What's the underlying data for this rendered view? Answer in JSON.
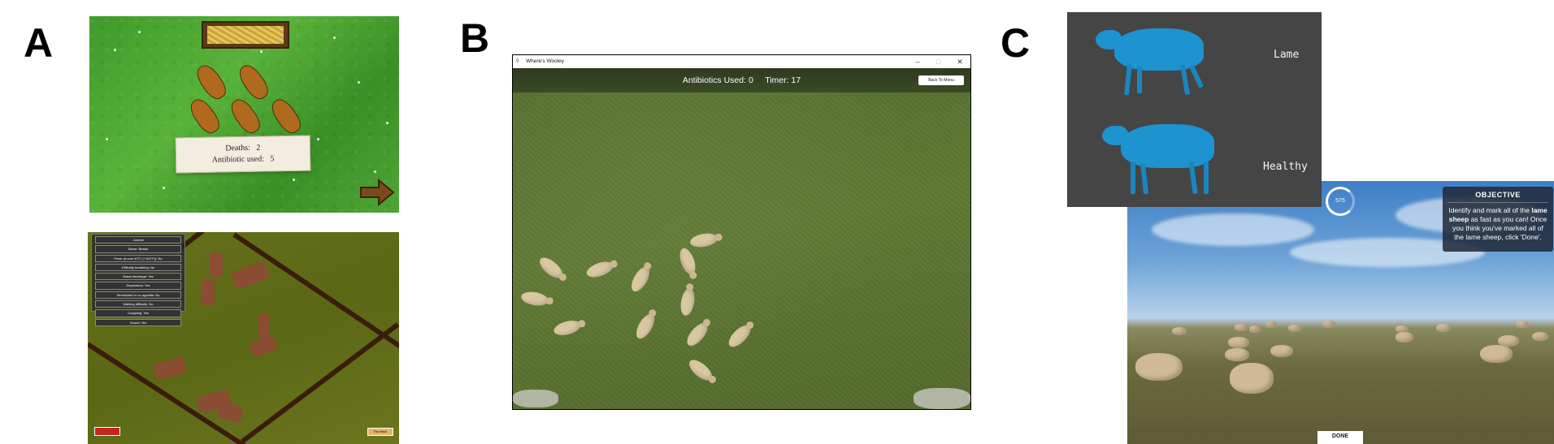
{
  "panels": {
    "a": {
      "letter": "A",
      "top_game": {
        "deaths_label": "Deaths:",
        "deaths_value": "2",
        "antibiotic_label": "Antibiotic used:",
        "antibiotic_value": "5"
      },
      "bottom_game": {
        "stats_rows": [
          "Journal",
          "Name: Bessie",
          "Fever (# core 40°C (+104°F)): No",
          "Difficulty breathing: No",
          "Nasal discharge: Yes",
          "Depression: Yes",
          "Diminished or no appetite: No",
          "Walking difficulty: No",
          "Coughing: Yes",
          "Sound: Yes"
        ],
        "finish_button": "Fat finish"
      }
    },
    "b": {
      "letter": "B",
      "window_title": "Where's Wooley",
      "hud": {
        "antibiotics_label": "Antibiotics Used:",
        "antibiotics_value": "0",
        "timer_label": "Timer:",
        "timer_value": "17"
      },
      "back_button": "Back To Menu",
      "controls": {
        "minimize": "–",
        "maximize": "□",
        "close": "✕"
      }
    },
    "c": {
      "letter": "C",
      "labels": {
        "lame": "Lame",
        "healthy": "Healthy"
      },
      "timer_value": "575",
      "objective": {
        "title": "OBJECTIVE",
        "text_a": "Identify and mark all of the",
        "text_bold": "lame sheep",
        "text_b": "as fast as you can! Once you think you've marked all of the lame sheep, click 'Done'."
      },
      "done_button": "DONE"
    }
  }
}
